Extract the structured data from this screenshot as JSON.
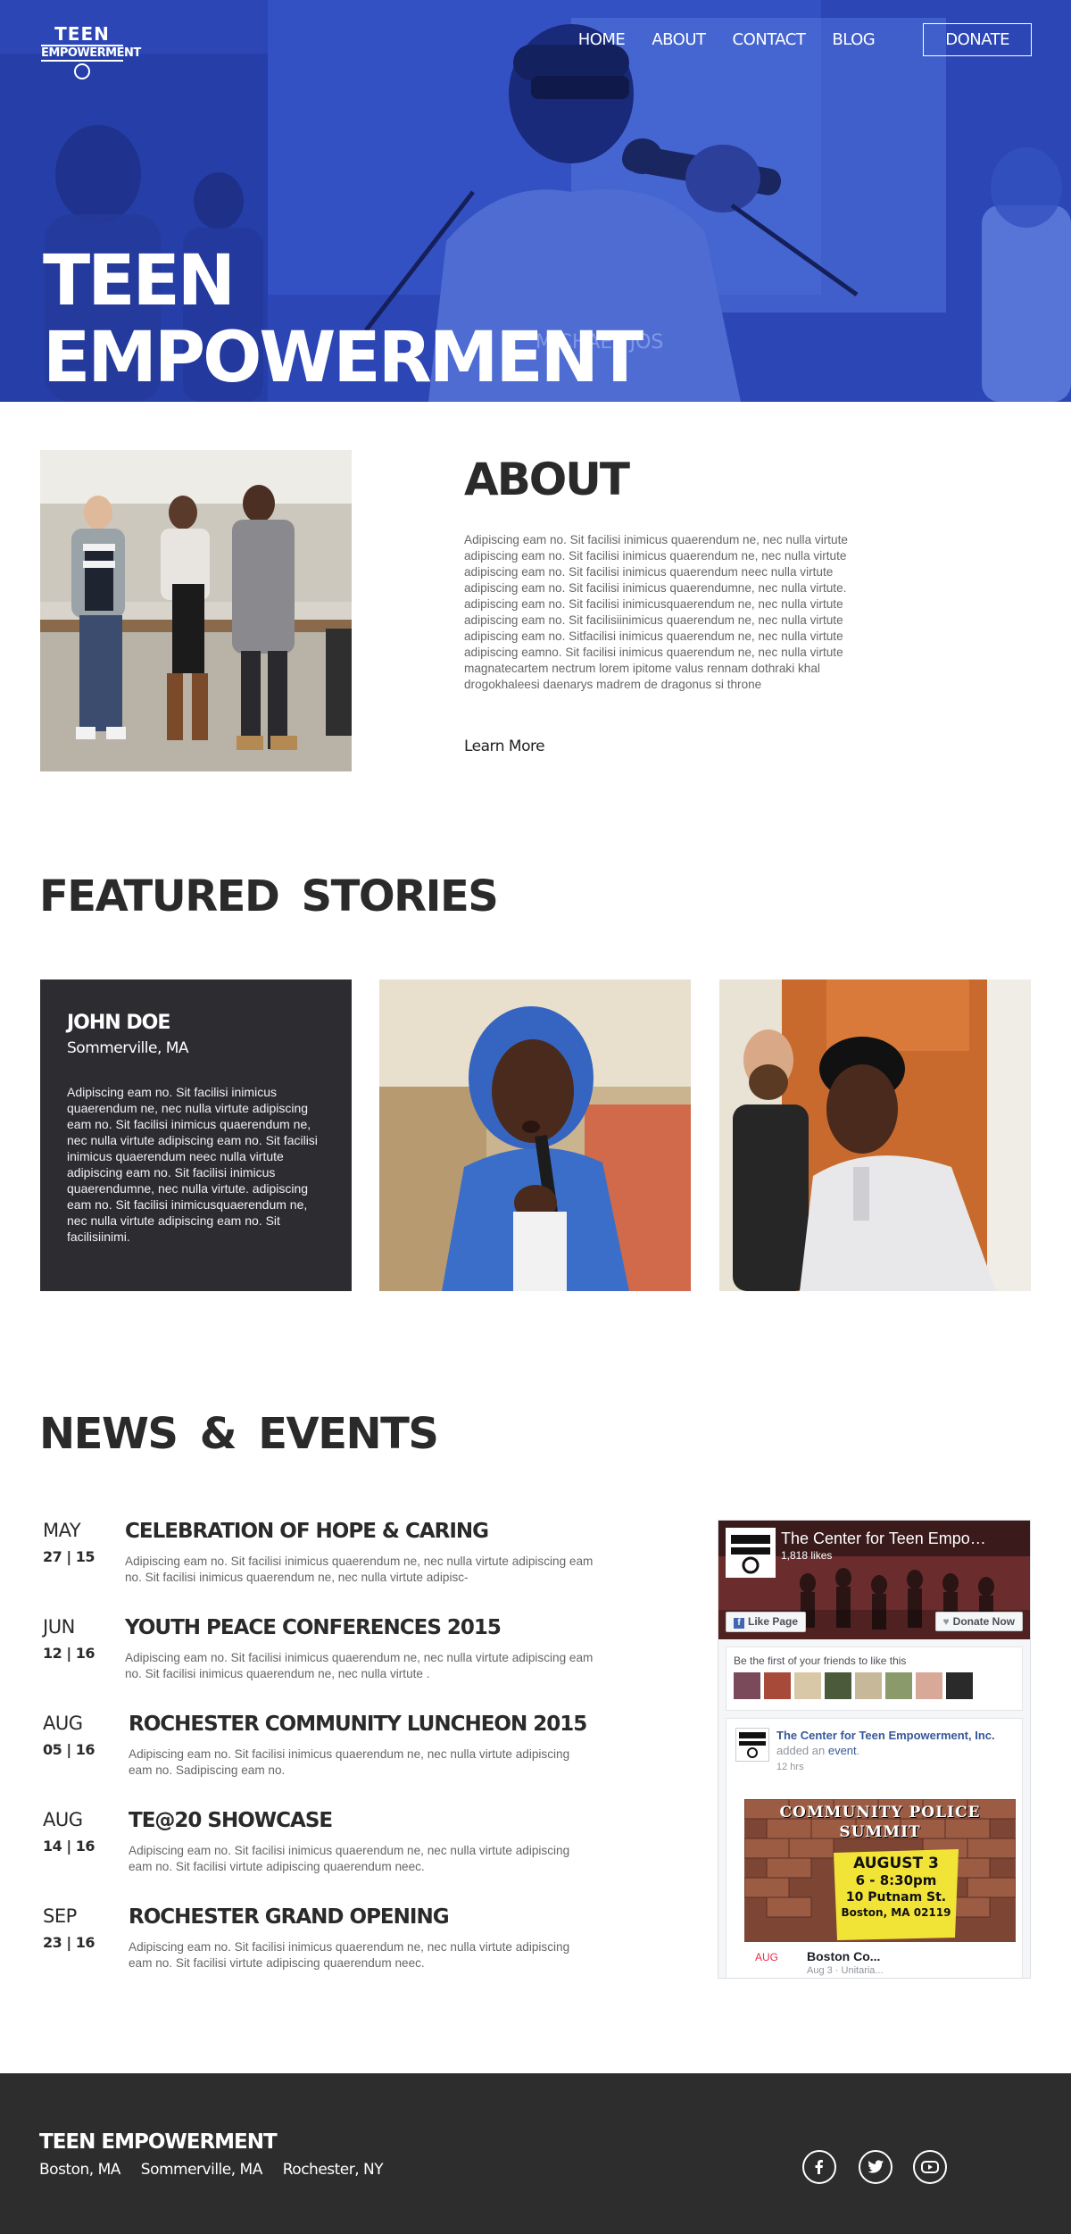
{
  "brand": {
    "logo_line1": "TEEN",
    "logo_line2": "EMPOWERMENT"
  },
  "nav": {
    "items": [
      "HOME",
      "ABOUT",
      "CONTACT",
      "BLOG"
    ],
    "donate_label": "DONATE"
  },
  "hero": {
    "title_line1": "TEEN",
    "title_line2": "EMPOWERMENT"
  },
  "about": {
    "title": "ABOUT",
    "text": "Adipiscing eam no. Sit facilisi inimicus quaerendum ne, nec nulla virtute adipiscing eam no. Sit facilisi inimicus quaerendum ne, nec nulla virtute adipiscing eam no. Sit facilisi inimicus quaerendum neec nulla virtute adipiscing eam no. Sit facilisi inimicus quaerendumne, nec nulla virtute. adipiscing eam no. Sit facilisi inimicusquaerendum ne, nec nulla virtute adipiscing eam no. Sit facilisiinimicus quaerendum ne, nec nulla virtute adipiscing eam no. Sitfacilisi inimicus quaerendum ne, nec nulla virtute adipiscing eamno. Sit facilisi inimicus quaerendum ne, nec nulla virtute magnatecartem nectrum lorem ipitome valus rennam dothraki khal drogokhaleesi daenarys madrem de dragonus si throne",
    "learn_more": "Learn More"
  },
  "featured": {
    "title": "FEATURED STORIES",
    "story": {
      "name": "JOHN DOE",
      "location": "Sommerville, MA",
      "text": "Adipiscing eam no. Sit facilisi inimicus quaerendum ne, nec nulla virtute adipiscing eam no. Sit facilisi inimicus quaerendum ne, nec nulla virtute adipiscing eam no. Sit facilisi inimicus quaerendum neec nulla virtute adipiscing eam no. Sit facilisi inimicus quaerendumne, nec nulla virtute. adipiscing eam no. Sit facilisi inimicusquaerendum ne, nec nulla virtute adipiscing eam no. Sit facilisiinimi."
    }
  },
  "news": {
    "title": "NEWS & EVENTS",
    "events": [
      {
        "month": "MAY",
        "date": "27 | 15",
        "title": "CELEBRATION OF HOPE & CARING",
        "desc": "Adipiscing eam no. Sit facilisi inimicus quaerendum ne, nec nulla virtute adipiscing eam no. Sit facilisi inimicus quaerendum ne, nec nulla virtute adipisc-"
      },
      {
        "month": "JUN",
        "date": "12 | 16",
        "title": "YOUTH PEACE CONFERENCES 2015",
        "desc": "Adipiscing eam no. Sit facilisi inimicus quaerendum ne, nec nulla virtute adipiscing eam no. Sit facilisi inimicus quaerendum ne, nec nulla virtute ."
      },
      {
        "month": "AUG",
        "date": "05 | 16",
        "title": "ROCHESTER COMMUNITY LUNCHEON 2015",
        "desc": "Adipiscing eam no. Sit facilisi inimicus quaerendum ne, nec nulla virtute adipiscing eam no. Sadipiscing eam no."
      },
      {
        "month": "AUG",
        "date": "14 | 16",
        "title": "TE@20 SHOWCASE",
        "desc": "Adipiscing eam no. Sit facilisi inimicus quaerendum ne, nec nulla virtute adipiscing eam no. Sit facilisi virtute adipiscing quaerendum neec."
      },
      {
        "month": "SEP",
        "date": "23 | 16",
        "title": "ROCHESTER GRAND OPENING",
        "desc": "Adipiscing eam no. Sit facilisi inimicus quaerendum ne, nec nulla virtute adipiscing eam no. Sit facilisi virtute adipiscing quaerendum neec."
      }
    ]
  },
  "facebook": {
    "page_name": "The Center for Teen Empo…",
    "likes": "1,818 likes",
    "like_label": "Like Page",
    "donate_label": "Donate Now",
    "friends_text": "Be the first of your friends to like this",
    "post_author": "The Center for Teen Empowerment, Inc.",
    "post_action": " added an ",
    "post_link": "event",
    "post_time": "12 hrs",
    "poster_line1": "COMMUNITY POLICE",
    "poster_line2": "SUMMIT",
    "poster_line3": "AUGUST 3",
    "poster_line4": "6 - 8:30pm",
    "poster_line5": "10 Putnam St.",
    "poster_line6": "Boston, MA 02119",
    "event_month": "AUG",
    "event_title": "Boston Co...",
    "event_sub": "Aug 3 · Unitaria..."
  },
  "footer": {
    "brand": "TEEN EMPOWERMENT",
    "cities": [
      "Boston, MA",
      "Sommerville, MA",
      "Rochester, NY"
    ],
    "social_icons": [
      "facebook-icon",
      "twitter-icon",
      "youtube-icon"
    ]
  },
  "colors": {
    "hero_blue": "#2b44b3",
    "dark": "#2d2d2d",
    "text_gray": "#666666",
    "fb_blue": "#365899"
  }
}
